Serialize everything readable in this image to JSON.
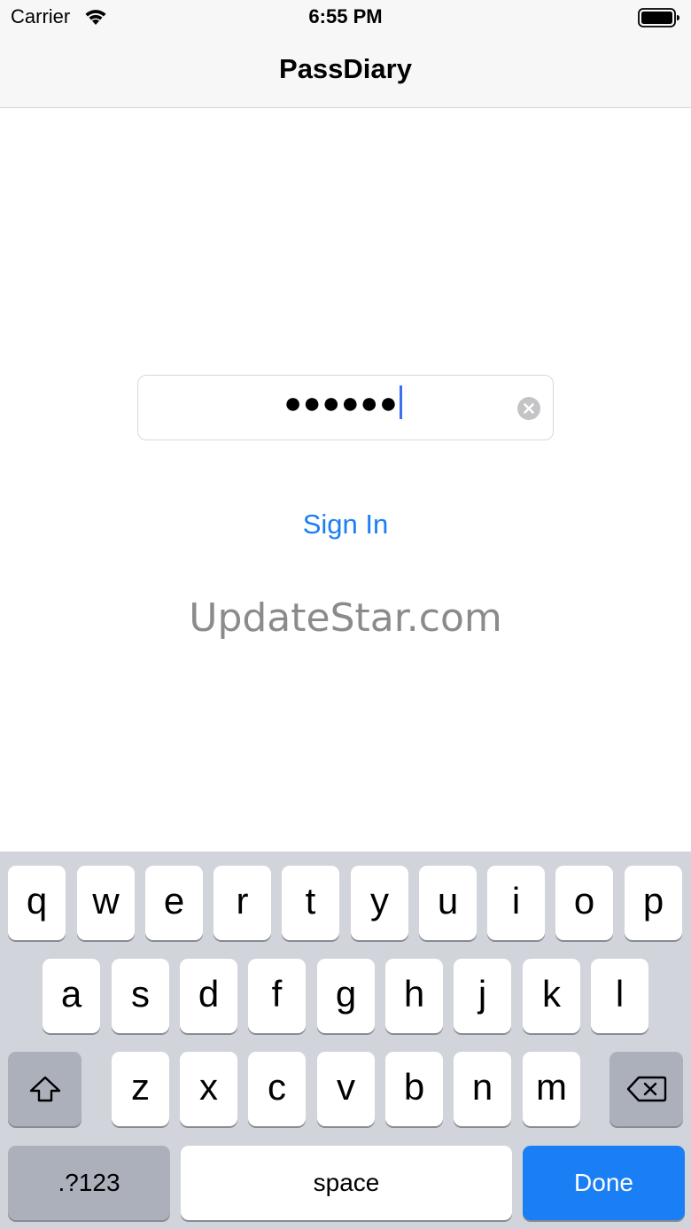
{
  "status_bar": {
    "carrier": "Carrier",
    "time": "6:55 PM"
  },
  "nav": {
    "title": "PassDiary"
  },
  "password_field": {
    "masked_value": "●●●●●●",
    "value_length": 6
  },
  "signin_label": "Sign In",
  "watermark": "UpdateStar.com",
  "keyboard": {
    "row1": [
      "q",
      "w",
      "e",
      "r",
      "t",
      "y",
      "u",
      "i",
      "o",
      "p"
    ],
    "row2": [
      "a",
      "s",
      "d",
      "f",
      "g",
      "h",
      "j",
      "k",
      "l"
    ],
    "row3": [
      "z",
      "x",
      "c",
      "v",
      "b",
      "n",
      "m"
    ],
    "numbers_label": ".?123",
    "space_label": "space",
    "done_label": "Done"
  },
  "colors": {
    "accent": "#1a7ef5",
    "caret": "#3d6ff2",
    "keyboard_bg": "#d1d4db"
  },
  "icons": [
    "wifi-icon",
    "battery-icon",
    "clear-text-icon",
    "shift-icon",
    "backspace-icon"
  ]
}
